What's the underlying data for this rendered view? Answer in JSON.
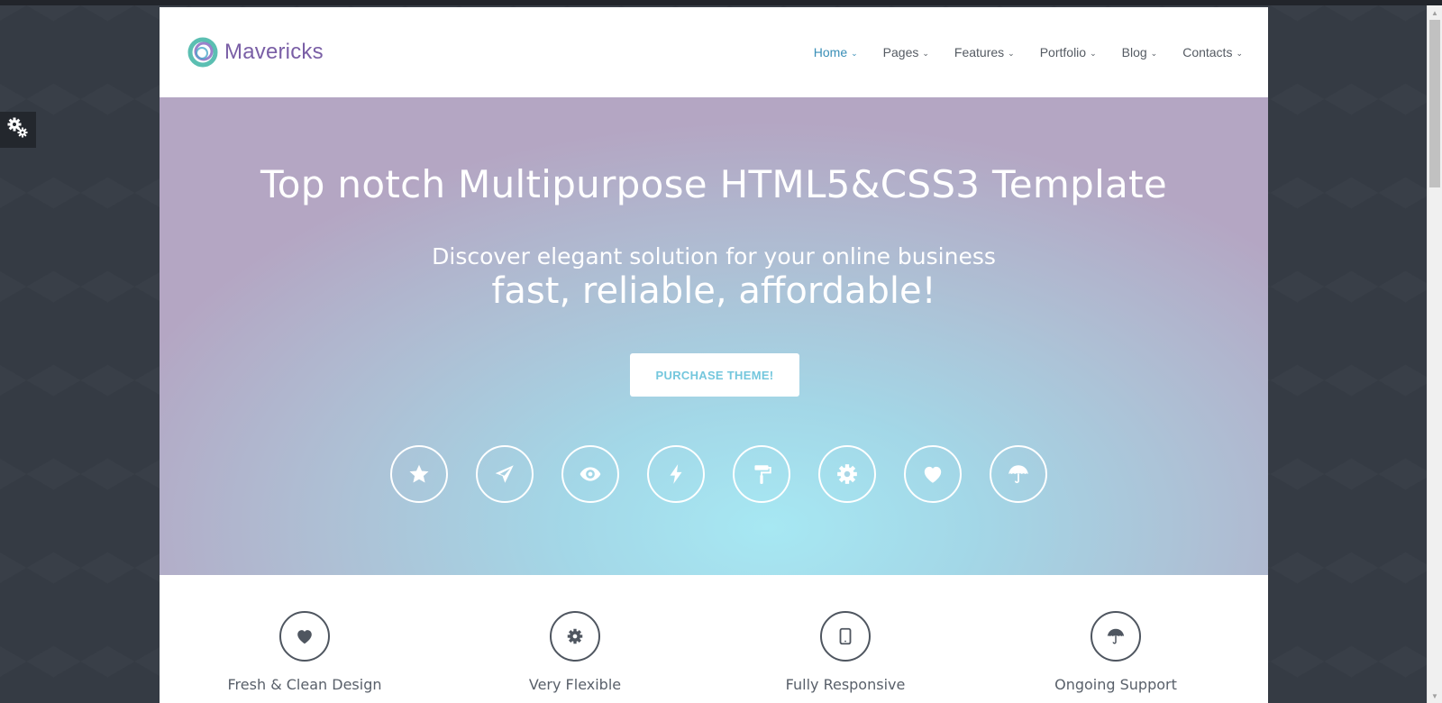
{
  "brand": {
    "name": "Mavericks",
    "colors": {
      "accent": "#3a8fb7",
      "logo_text": "#7a5fa6",
      "logo_ring_outer": "#5bbfb2",
      "logo_ring_inner": "#8a6cc2"
    }
  },
  "nav": {
    "items": [
      {
        "label": "Home",
        "active": true
      },
      {
        "label": "Pages",
        "active": false
      },
      {
        "label": "Features",
        "active": false
      },
      {
        "label": "Portfolio",
        "active": false
      },
      {
        "label": "Blog",
        "active": false
      },
      {
        "label": "Contacts",
        "active": false
      }
    ]
  },
  "hero": {
    "title": "Top notch Multipurpose HTML5&CSS3 Template",
    "subtitle": "Discover elegant solution for your online business",
    "tagline": "fast, reliable, affordable!",
    "cta_label": "PURCHASE THEME!",
    "icons": [
      "star-icon",
      "paper-plane-icon",
      "eye-icon",
      "bolt-icon",
      "paint-roller-icon",
      "gear-icon",
      "heart-icon",
      "umbrella-icon"
    ]
  },
  "features": [
    {
      "title": "Fresh & Clean Design",
      "icon": "heart-icon"
    },
    {
      "title": "Very Flexible",
      "icon": "gear-icon"
    },
    {
      "title": "Fully Responsive",
      "icon": "tablet-icon"
    },
    {
      "title": "Ongoing Support",
      "icon": "umbrella-icon"
    }
  ],
  "side_panel": {
    "icon": "settings-gears-icon"
  }
}
